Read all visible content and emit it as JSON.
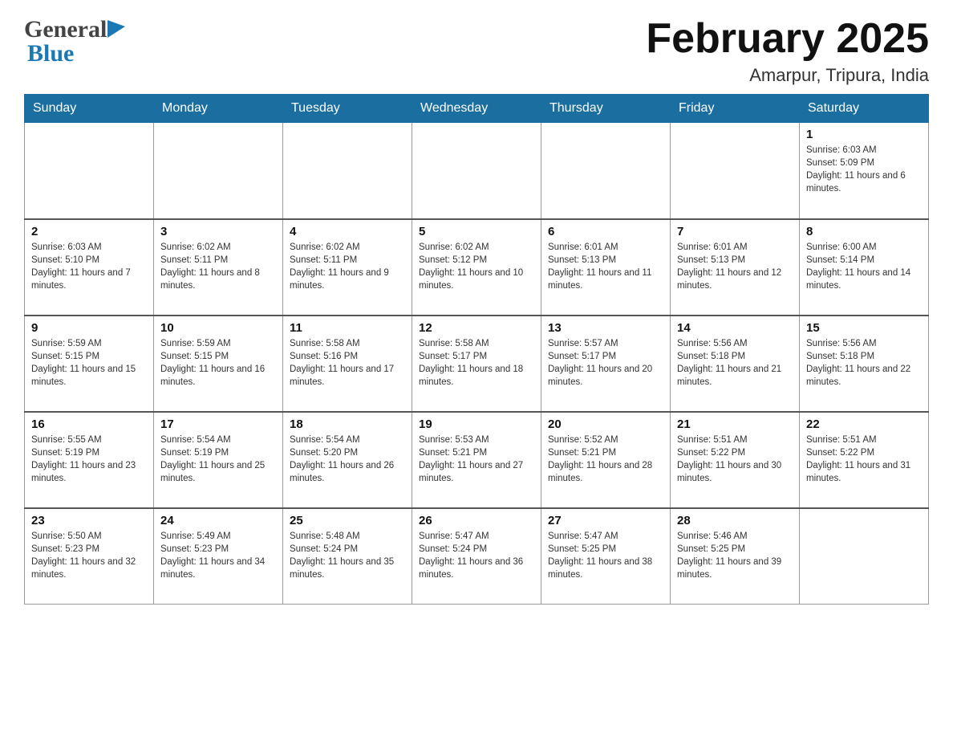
{
  "header": {
    "logo": {
      "general": "General",
      "blue": "Blue"
    },
    "title": "February 2025",
    "location": "Amarpur, Tripura, India"
  },
  "days_of_week": [
    "Sunday",
    "Monday",
    "Tuesday",
    "Wednesday",
    "Thursday",
    "Friday",
    "Saturday"
  ],
  "weeks": [
    {
      "days": [
        {
          "num": "",
          "info": ""
        },
        {
          "num": "",
          "info": ""
        },
        {
          "num": "",
          "info": ""
        },
        {
          "num": "",
          "info": ""
        },
        {
          "num": "",
          "info": ""
        },
        {
          "num": "",
          "info": ""
        },
        {
          "num": "1",
          "info": "Sunrise: 6:03 AM\nSunset: 5:09 PM\nDaylight: 11 hours and 6 minutes."
        }
      ]
    },
    {
      "days": [
        {
          "num": "2",
          "info": "Sunrise: 6:03 AM\nSunset: 5:10 PM\nDaylight: 11 hours and 7 minutes."
        },
        {
          "num": "3",
          "info": "Sunrise: 6:02 AM\nSunset: 5:11 PM\nDaylight: 11 hours and 8 minutes."
        },
        {
          "num": "4",
          "info": "Sunrise: 6:02 AM\nSunset: 5:11 PM\nDaylight: 11 hours and 9 minutes."
        },
        {
          "num": "5",
          "info": "Sunrise: 6:02 AM\nSunset: 5:12 PM\nDaylight: 11 hours and 10 minutes."
        },
        {
          "num": "6",
          "info": "Sunrise: 6:01 AM\nSunset: 5:13 PM\nDaylight: 11 hours and 11 minutes."
        },
        {
          "num": "7",
          "info": "Sunrise: 6:01 AM\nSunset: 5:13 PM\nDaylight: 11 hours and 12 minutes."
        },
        {
          "num": "8",
          "info": "Sunrise: 6:00 AM\nSunset: 5:14 PM\nDaylight: 11 hours and 14 minutes."
        }
      ]
    },
    {
      "days": [
        {
          "num": "9",
          "info": "Sunrise: 5:59 AM\nSunset: 5:15 PM\nDaylight: 11 hours and 15 minutes."
        },
        {
          "num": "10",
          "info": "Sunrise: 5:59 AM\nSunset: 5:15 PM\nDaylight: 11 hours and 16 minutes."
        },
        {
          "num": "11",
          "info": "Sunrise: 5:58 AM\nSunset: 5:16 PM\nDaylight: 11 hours and 17 minutes."
        },
        {
          "num": "12",
          "info": "Sunrise: 5:58 AM\nSunset: 5:17 PM\nDaylight: 11 hours and 18 minutes."
        },
        {
          "num": "13",
          "info": "Sunrise: 5:57 AM\nSunset: 5:17 PM\nDaylight: 11 hours and 20 minutes."
        },
        {
          "num": "14",
          "info": "Sunrise: 5:56 AM\nSunset: 5:18 PM\nDaylight: 11 hours and 21 minutes."
        },
        {
          "num": "15",
          "info": "Sunrise: 5:56 AM\nSunset: 5:18 PM\nDaylight: 11 hours and 22 minutes."
        }
      ]
    },
    {
      "days": [
        {
          "num": "16",
          "info": "Sunrise: 5:55 AM\nSunset: 5:19 PM\nDaylight: 11 hours and 23 minutes."
        },
        {
          "num": "17",
          "info": "Sunrise: 5:54 AM\nSunset: 5:19 PM\nDaylight: 11 hours and 25 minutes."
        },
        {
          "num": "18",
          "info": "Sunrise: 5:54 AM\nSunset: 5:20 PM\nDaylight: 11 hours and 26 minutes."
        },
        {
          "num": "19",
          "info": "Sunrise: 5:53 AM\nSunset: 5:21 PM\nDaylight: 11 hours and 27 minutes."
        },
        {
          "num": "20",
          "info": "Sunrise: 5:52 AM\nSunset: 5:21 PM\nDaylight: 11 hours and 28 minutes."
        },
        {
          "num": "21",
          "info": "Sunrise: 5:51 AM\nSunset: 5:22 PM\nDaylight: 11 hours and 30 minutes."
        },
        {
          "num": "22",
          "info": "Sunrise: 5:51 AM\nSunset: 5:22 PM\nDaylight: 11 hours and 31 minutes."
        }
      ]
    },
    {
      "days": [
        {
          "num": "23",
          "info": "Sunrise: 5:50 AM\nSunset: 5:23 PM\nDaylight: 11 hours and 32 minutes."
        },
        {
          "num": "24",
          "info": "Sunrise: 5:49 AM\nSunset: 5:23 PM\nDaylight: 11 hours and 34 minutes."
        },
        {
          "num": "25",
          "info": "Sunrise: 5:48 AM\nSunset: 5:24 PM\nDaylight: 11 hours and 35 minutes."
        },
        {
          "num": "26",
          "info": "Sunrise: 5:47 AM\nSunset: 5:24 PM\nDaylight: 11 hours and 36 minutes."
        },
        {
          "num": "27",
          "info": "Sunrise: 5:47 AM\nSunset: 5:25 PM\nDaylight: 11 hours and 38 minutes."
        },
        {
          "num": "28",
          "info": "Sunrise: 5:46 AM\nSunset: 5:25 PM\nDaylight: 11 hours and 39 minutes."
        },
        {
          "num": "",
          "info": ""
        }
      ]
    }
  ]
}
